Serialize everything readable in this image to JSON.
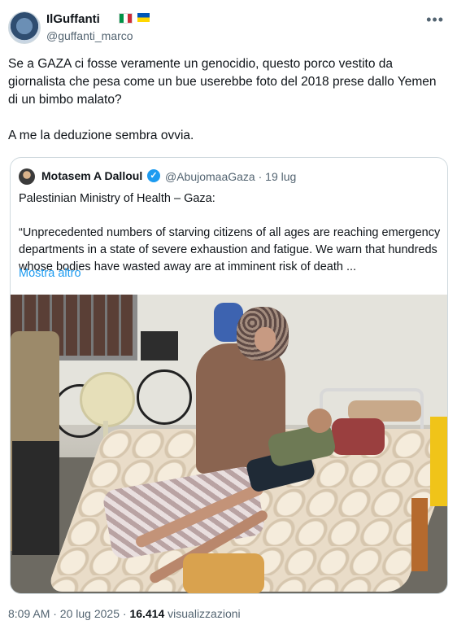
{
  "author": {
    "name": "IlGuffanti",
    "handle": "@guffanti_marco",
    "flags": [
      "italy-flag",
      "ukraine-flag"
    ]
  },
  "menu_icon": "more-horizontal-icon",
  "tweet": {
    "text": "Se a GAZA ci fosse veramente un genocidio, questo porco vestito da giornalista che pesa come un bue userebbe foto del 2018 prese dallo Yemen di un bimbo malato?\n\nA me la deduzione sembra ovvia."
  },
  "quote": {
    "author_name": "Motasem A Dalloul",
    "handle_time": "@AbujomaaGaza · 19 lug",
    "body": "Palestinian Ministry of Health – Gaza:\n\n“Unprecedented numbers of starving citizens of all ages are reaching emergency departments in a state of severe exhaustion and fatigue. We warn that hundreds whose bodies have wasted away are at imminent risk of death ...",
    "show_more": "Mostra altro"
  },
  "meta": {
    "time_date": "8:09 AM · 20 lug 2025 · ",
    "views_count": "16.414",
    "views_label": " visualizzazioni"
  },
  "colors": {
    "link": "#1d9bf0",
    "secondary_text": "#536471",
    "verified_badge": "#1d9bf0"
  }
}
